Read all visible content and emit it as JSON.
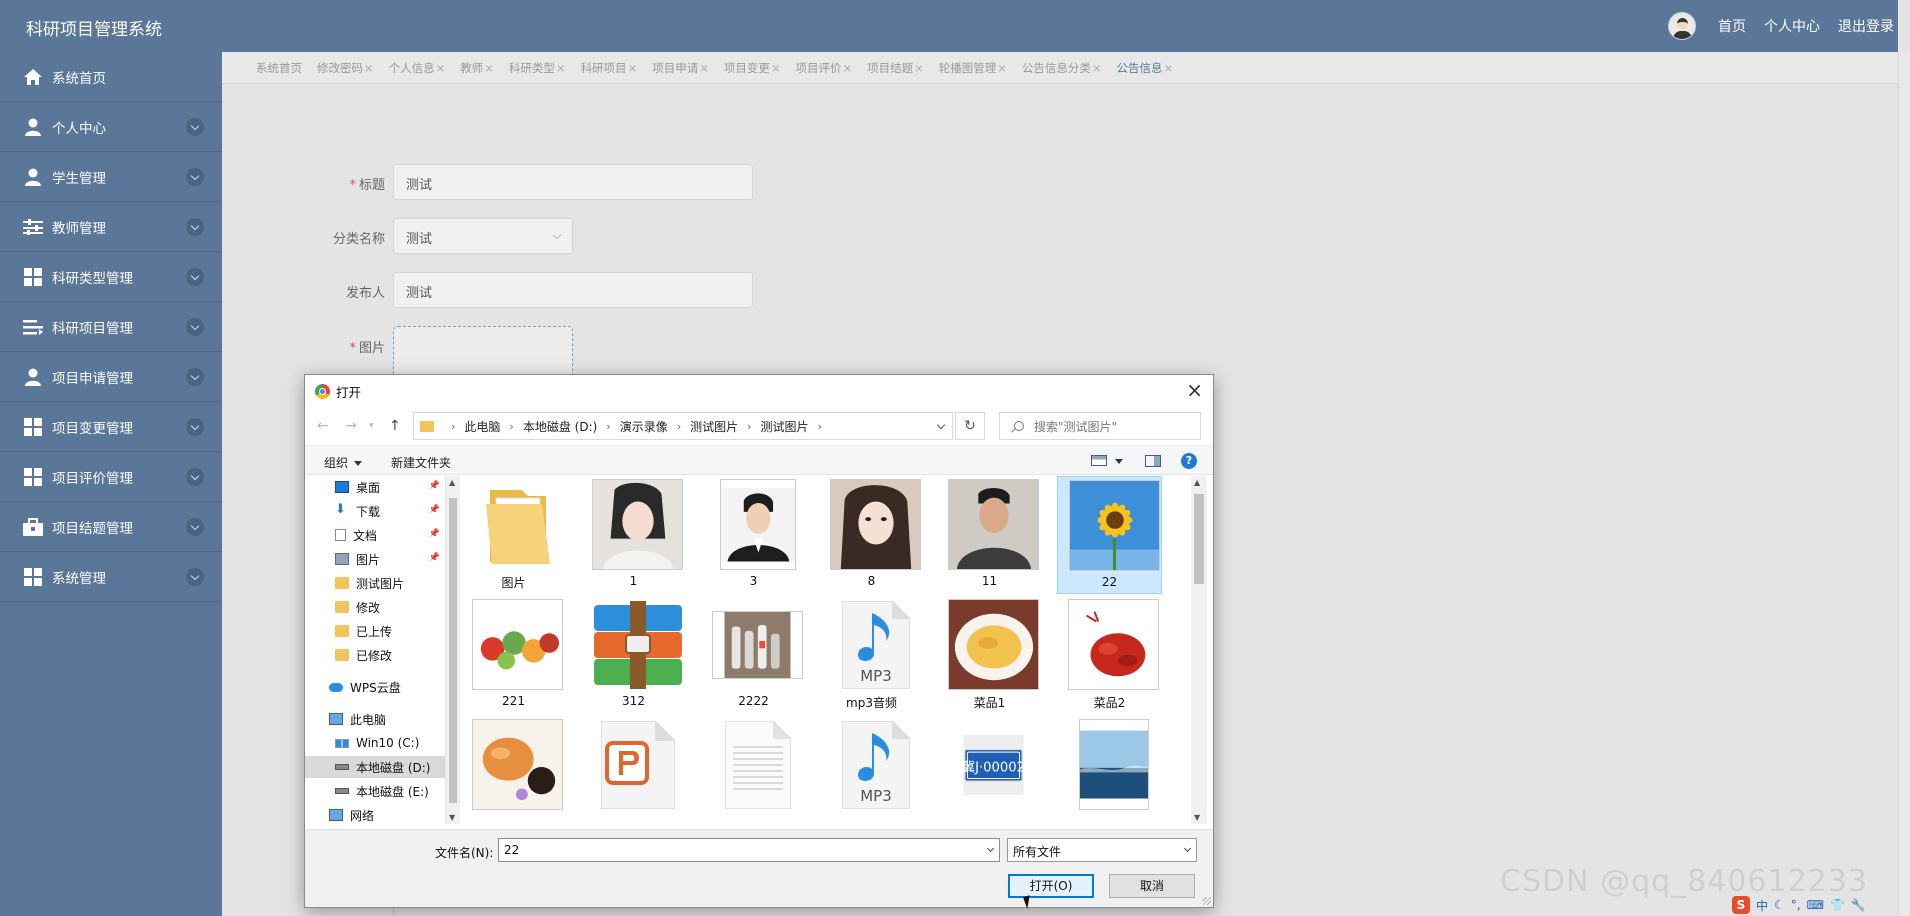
{
  "app": {
    "title": "科研项目管理系统"
  },
  "header": {
    "links": [
      "首页",
      "个人中心",
      "退出登录"
    ]
  },
  "sidebar": {
    "items": [
      {
        "label": "系统首页",
        "icon": "home-icon"
      },
      {
        "label": "个人中心",
        "icon": "user-icon"
      },
      {
        "label": "学生管理",
        "icon": "user-icon"
      },
      {
        "label": "教师管理",
        "icon": "sliders-icon"
      },
      {
        "label": "科研类型管理",
        "icon": "grid-icon"
      },
      {
        "label": "科研项目管理",
        "icon": "list-icon"
      },
      {
        "label": "项目申请管理",
        "icon": "user-icon"
      },
      {
        "label": "项目变更管理",
        "icon": "grid-icon"
      },
      {
        "label": "项目评价管理",
        "icon": "grid-icon"
      },
      {
        "label": "项目结题管理",
        "icon": "briefcase-icon"
      },
      {
        "label": "系统管理",
        "icon": "grid-icon"
      }
    ]
  },
  "tabs": [
    {
      "label": "系统首页",
      "closable": false
    },
    {
      "label": "修改密码",
      "closable": true
    },
    {
      "label": "个人信息",
      "closable": true
    },
    {
      "label": "教师",
      "closable": true
    },
    {
      "label": "科研类型",
      "closable": true
    },
    {
      "label": "科研项目",
      "closable": true
    },
    {
      "label": "项目申请",
      "closable": true
    },
    {
      "label": "项目变更",
      "closable": true
    },
    {
      "label": "项目评价",
      "closable": true
    },
    {
      "label": "项目结题",
      "closable": true
    },
    {
      "label": "轮播图管理",
      "closable": true
    },
    {
      "label": "公告信息分类",
      "closable": true
    },
    {
      "label": "公告信息",
      "closable": true,
      "active": true
    }
  ],
  "form": {
    "title_label": "标题",
    "title_value": "测试",
    "category_label": "分类名称",
    "category_value": "测试",
    "publisher_label": "发布人",
    "publisher_value": "测试",
    "image_label": "图片"
  },
  "dialog": {
    "title": "打开",
    "close_glyph": "×",
    "breadcrumb": [
      "此电脑",
      "本地磁盘 (D:)",
      "演示录像",
      "测试图片",
      "测试图片"
    ],
    "search_placeholder": "搜索\"测试图片\"",
    "toolbar": {
      "organize": "组织",
      "new_folder": "新建文件夹",
      "help": "?"
    },
    "nav_tree": [
      {
        "label": "桌面",
        "icon": "desktop-icon",
        "pinned": true
      },
      {
        "label": "下载",
        "icon": "download-icon",
        "pinned": true
      },
      {
        "label": "文档",
        "icon": "document-icon",
        "pinned": true
      },
      {
        "label": "图片",
        "icon": "pictures-icon",
        "pinned": true
      },
      {
        "label": "测试图片",
        "icon": "folder-icon"
      },
      {
        "label": "修改",
        "icon": "folder-icon"
      },
      {
        "label": "已上传",
        "icon": "folder-icon"
      },
      {
        "label": "已修改",
        "icon": "folder-icon"
      },
      {
        "label": "WPS云盘",
        "icon": "cloud-icon"
      },
      {
        "label": "此电脑",
        "icon": "computer-icon"
      },
      {
        "label": "Win10 (C:)",
        "icon": "windows-drive-icon"
      },
      {
        "label": "本地磁盘 (D:)",
        "icon": "drive-icon",
        "selected": true
      },
      {
        "label": "本地磁盘 (E:)",
        "icon": "drive-icon"
      },
      {
        "label": "网络",
        "icon": "network-icon"
      }
    ],
    "files": [
      {
        "name": "图片",
        "kind": "folder"
      },
      {
        "name": "1",
        "kind": "portrait-woman-hanfu"
      },
      {
        "name": "3",
        "kind": "portrait-man-suit"
      },
      {
        "name": "8",
        "kind": "portrait-woman"
      },
      {
        "name": "11",
        "kind": "portrait-man"
      },
      {
        "name": "22",
        "kind": "sunflower",
        "selected": true
      },
      {
        "name": "221",
        "kind": "vegetables"
      },
      {
        "name": "312",
        "kind": "winrar-archive"
      },
      {
        "name": "2222",
        "kind": "bottles"
      },
      {
        "name": "mp3音频",
        "kind": "mp3"
      },
      {
        "name": "菜品1",
        "kind": "dish-yellow"
      },
      {
        "name": "菜品2",
        "kind": "crayfish"
      },
      {
        "name": "",
        "kind": "shrimp-dish"
      },
      {
        "name": "",
        "kind": "ppt-file"
      },
      {
        "name": "",
        "kind": "text-file"
      },
      {
        "name": "",
        "kind": "mp3"
      },
      {
        "name": "",
        "kind": "license-plate",
        "plate_text": "冀J·00002"
      },
      {
        "name": "",
        "kind": "sea-poster"
      }
    ],
    "filename_label": "文件名(N):",
    "filename_value": "22",
    "filetype_value": "所有文件",
    "open_button": "打开(O)",
    "cancel_button": "取消",
    "mp3_label": "MP3"
  },
  "watermark": "CSDN @qq_840612233",
  "tray": {
    "ime": "中"
  },
  "colors": {
    "sidebar": "#5a7698",
    "accent": "#1e7ad6",
    "selected": "#cce8ff",
    "required": "#e05050"
  }
}
